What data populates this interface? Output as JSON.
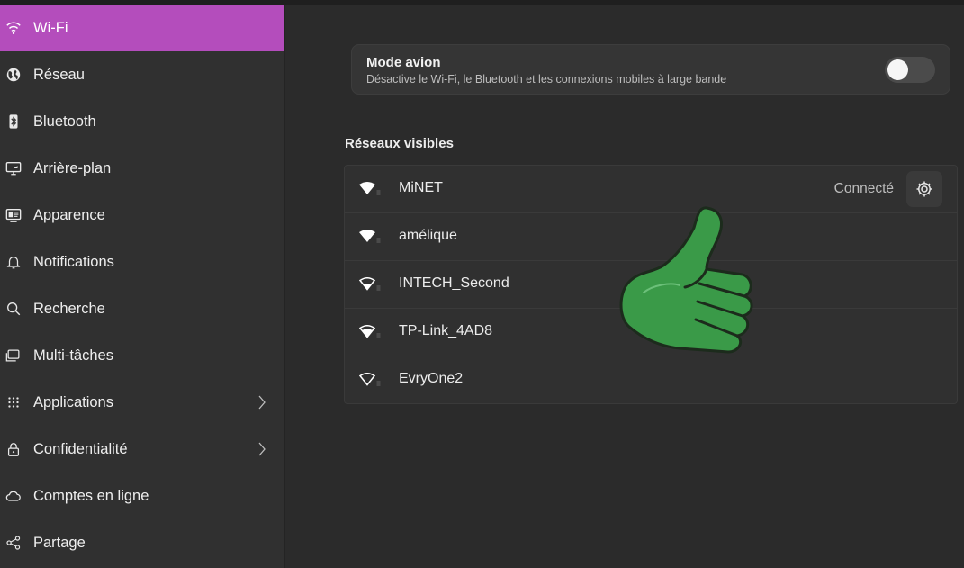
{
  "sidebar": {
    "items": [
      {
        "label": "Wi-Fi",
        "icon": "wifi-icon",
        "active": true
      },
      {
        "label": "Réseau",
        "icon": "globe-icon"
      },
      {
        "label": "Bluetooth",
        "icon": "bluetooth-icon"
      },
      {
        "label": "Arrière-plan",
        "icon": "monitor-icon"
      },
      {
        "label": "Apparence",
        "icon": "appearance-icon"
      },
      {
        "label": "Notifications",
        "icon": "bell-icon"
      },
      {
        "label": "Recherche",
        "icon": "search-icon"
      },
      {
        "label": "Multi-tâches",
        "icon": "multitask-icon"
      },
      {
        "label": "Applications",
        "icon": "grid-icon",
        "chevron": true
      },
      {
        "label": "Confidentialité",
        "icon": "lock-icon",
        "chevron": true
      },
      {
        "label": "Comptes en ligne",
        "icon": "cloud-icon"
      },
      {
        "label": "Partage",
        "icon": "share-icon"
      }
    ]
  },
  "airplane": {
    "title": "Mode avion",
    "subtitle": "Désactive le Wi-Fi, le Bluetooth et les connexions mobiles à large bande",
    "enabled": false
  },
  "networks": {
    "section_title": "Réseaux visibles",
    "items": [
      {
        "name": "MiNET",
        "status": "Connecté",
        "signal": "full"
      },
      {
        "name": "amélique",
        "status": "",
        "signal": "full"
      },
      {
        "name": "INTECH_Second",
        "status": "",
        "signal": "outline"
      },
      {
        "name": "TP-Link_4AD8",
        "status": "",
        "signal": "mid"
      },
      {
        "name": "EvryOne2",
        "status": "",
        "signal": "outline"
      }
    ]
  },
  "colors": {
    "accent": "#b44dbc",
    "thumb_green": "#3a9a48"
  }
}
